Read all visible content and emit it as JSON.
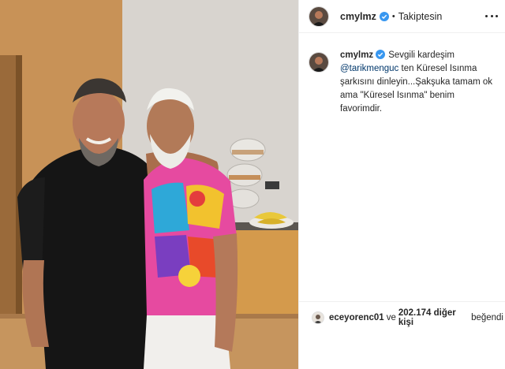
{
  "post": {
    "username": "cmylmz",
    "follow_status": "Takiptesin",
    "separator": "•",
    "header_avatar_icon": "profile-avatar-icon",
    "verified_icon": "verified-badge-icon",
    "more_icon": "more-options-icon"
  },
  "caption": {
    "username": "cmylmz",
    "text_1": "Sevgili kardeşim",
    "mention": "@tarikmenguc",
    "text_2": "ten Küresel Isınma şarkısını dinleyin...Şakşuka tamam ok ama \"Küresel Isınma\" benim favorimdir."
  },
  "likes": {
    "first_liker": "eceyorenc01",
    "conjunction": "ve",
    "others": "202.174 diğer kişi",
    "suffix": "beğendi"
  },
  "colors": {
    "verified_blue": "#3897f0",
    "mention_blue": "#00376b",
    "text": "#262626",
    "divider": "#efefef"
  }
}
